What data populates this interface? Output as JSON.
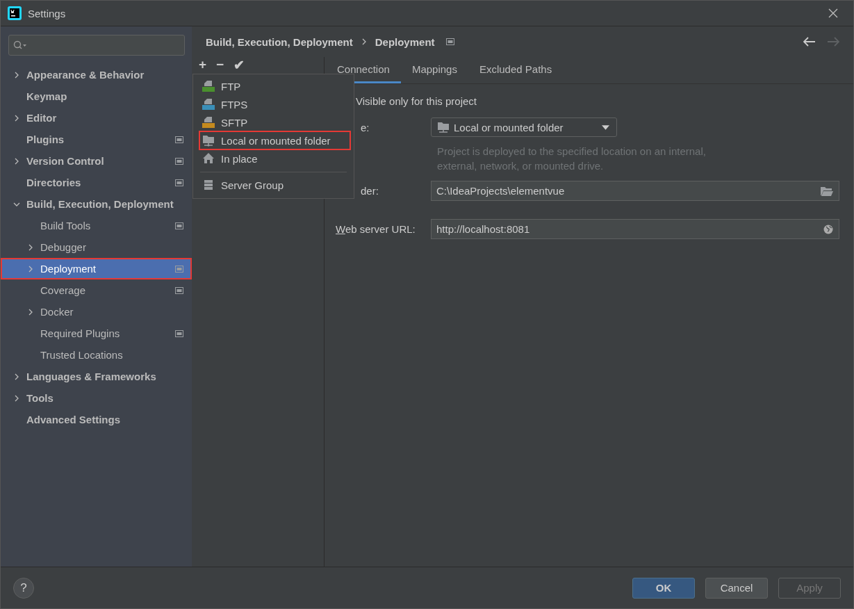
{
  "window": {
    "title": "Settings"
  },
  "sidebar": {
    "items": [
      {
        "label": "Appearance & Behavior",
        "kind": "collapsed",
        "project_level": false,
        "selected": false,
        "annotated": false
      },
      {
        "label": "Keymap",
        "kind": "leaf",
        "project_level": false,
        "selected": false,
        "annotated": false
      },
      {
        "label": "Editor",
        "kind": "collapsed",
        "project_level": false,
        "selected": false,
        "annotated": false
      },
      {
        "label": "Plugins",
        "kind": "leaf",
        "project_level": true,
        "selected": false,
        "annotated": false
      },
      {
        "label": "Version Control",
        "kind": "collapsed",
        "project_level": true,
        "selected": false,
        "annotated": false
      },
      {
        "label": "Directories",
        "kind": "leaf",
        "project_level": true,
        "selected": false,
        "annotated": false
      },
      {
        "label": "Build, Execution, Deployment",
        "kind": "expanded",
        "project_level": false,
        "selected": false,
        "annotated": false,
        "children": [
          {
            "label": "Build Tools",
            "kind": "leaf",
            "project_level": true,
            "selected": false,
            "annotated": false
          },
          {
            "label": "Debugger",
            "kind": "collapsed",
            "project_level": false,
            "selected": false,
            "annotated": false
          },
          {
            "label": "Deployment",
            "kind": "collapsed",
            "project_level": true,
            "selected": true,
            "annotated": true
          },
          {
            "label": "Coverage",
            "kind": "leaf",
            "project_level": true,
            "selected": false,
            "annotated": false
          },
          {
            "label": "Docker",
            "kind": "collapsed",
            "project_level": false,
            "selected": false,
            "annotated": false
          },
          {
            "label": "Required Plugins",
            "kind": "leaf",
            "project_level": true,
            "selected": false,
            "annotated": false
          },
          {
            "label": "Trusted Locations",
            "kind": "leaf",
            "project_level": false,
            "selected": false,
            "annotated": false
          }
        ]
      },
      {
        "label": "Languages & Frameworks",
        "kind": "collapsed",
        "project_level": false,
        "selected": false,
        "annotated": false
      },
      {
        "label": "Tools",
        "kind": "collapsed",
        "project_level": false,
        "selected": false,
        "annotated": false
      },
      {
        "label": "Advanced Settings",
        "kind": "leaf",
        "project_level": false,
        "selected": false,
        "annotated": false
      }
    ]
  },
  "breadcrumb": [
    "Build, Execution, Deployment",
    "Deployment"
  ],
  "navigation": {
    "back_enabled": true,
    "forward_enabled": false
  },
  "toolbar": [
    "+",
    "−",
    "✔"
  ],
  "menu": {
    "sections": [
      {
        "items": [
          {
            "label": "FTP",
            "kind": "ftp",
            "annotated": false
          },
          {
            "label": "FTPS",
            "kind": "ftps",
            "annotated": false
          },
          {
            "label": "SFTP",
            "kind": "sftp",
            "annotated": false
          },
          {
            "label": "Local or mounted folder",
            "kind": "folder",
            "annotated": true
          },
          {
            "label": "In place",
            "kind": "home",
            "annotated": false
          }
        ]
      },
      {
        "items": [
          {
            "label": "Server Group",
            "kind": "server-group",
            "annotated": false
          }
        ]
      }
    ]
  },
  "tabs": [
    {
      "label": "Connection",
      "selected": true
    },
    {
      "label": "Mappings",
      "selected": false
    },
    {
      "label": "Excluded Paths",
      "selected": false
    }
  ],
  "connection": {
    "visible_label": "Visible only for this project",
    "type_label": "e:",
    "type_value": "Local or mounted folder",
    "description": "Project is deployed to the specified location on an internal, external, network, or mounted drive.",
    "folder_label": "der:",
    "folder_value": "C:\\IdeaProjects\\elementvue",
    "url_label": "Web server URL:",
    "url_value": "http://localhost:8081"
  },
  "help_button": "?",
  "buttons": [
    {
      "label": "OK",
      "kind": "default",
      "disabled": false
    },
    {
      "label": "Cancel",
      "kind": "normal",
      "disabled": false
    },
    {
      "label": "Apply",
      "kind": "normal",
      "disabled": true
    }
  ]
}
